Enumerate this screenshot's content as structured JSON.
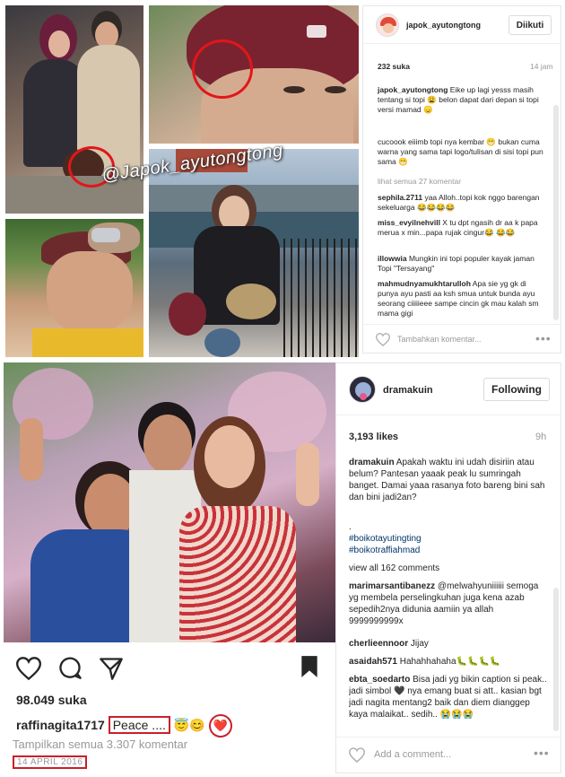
{
  "watermark": "@Japok_ayutongtong",
  "post1": {
    "username": "japok_ayutongtong",
    "follow_label": "Diikuti",
    "likes": "232 suka",
    "time": "14 jam",
    "caption": [
      {
        "user": "japok_ayutongtong",
        "text": " Eike up lagi yesss masih tentang si topi 😩 belon dapat dari depan si topi versi mamad 😞"
      },
      {
        "user": "",
        "text": "cucoook eiiimb topi nya kembar 😁 bukan cuma warna yang sama tapi logo/tulisan di sisi topi pun sama 😁"
      }
    ],
    "view_all": "lihat semua 27 komentar",
    "comments": [
      {
        "user": "sephila.2711",
        "text": " yaa Alloh..topi kok nggo barengan sekeluarga 😂😂😂😂"
      },
      {
        "user": "miss_evyilnehvill",
        "text": " X tu dpt ngasih dr aa k papa merua x min...papa rujak cingur😂 😂😂"
      },
      {
        "user": "illowwia",
        "text": " Mungkin ini topi populer kayak jaman Topi \"Tersayang\""
      },
      {
        "user": "mahmudnyamukhtarulloh",
        "text": " Apa sie yg gk di punya ayu pasti aa ksh smua untuk bunda ayu seorang ciiiiieee sampe cincin gk mau kalah sm mama gigi"
      }
    ],
    "add_comment": "Tambahkan komentar...",
    "more": "•••"
  },
  "post2": {
    "username": "dramakuin",
    "follow_label": "Following",
    "likes": "3,193 likes",
    "time": "9h",
    "caption_user": "dramakuin",
    "caption_text": " Apakah waktu ini udah disiriin atau belum? Pantesan yaaak peak lu sumringah banget. Damai yaaa rasanya foto bareng bini sah dan bini jadi2an?",
    "caption_dot": ".",
    "hashtags": [
      "#boikotayutingting",
      "#boikotraffiahmad"
    ],
    "view_all": "view all 162 comments",
    "comments": [
      {
        "user": "marimarsantibanezz",
        "text": " @melwahyuniiiiii semoga yg membela perselingkuhan juga kena azab sepedih2nya didunia aamiin ya allah 9999999999x"
      },
      {
        "user": "cherlieennoor",
        "text": " Jijay"
      },
      {
        "user": "asaidah571",
        "text": " Hahahhahaha🐛🐛🐛🐛"
      },
      {
        "user": "ebta_soedarto",
        "text": " Bisa jadi yg bikin caption si peak.. jadi simbol 🖤 nya emang buat si att.. kasian bgt jadi nagita mentang2 baik dan diem dianggep kaya malaikat.. sedih.. 😭😭😭"
      }
    ],
    "add_comment": "Add a comment...",
    "more": "•••"
  },
  "post3": {
    "likes": "98.049 suka",
    "username": "raffinagita1717",
    "caption_text": "Peace ....",
    "caption_emoji": "😇😊",
    "heart": "❤️",
    "view_all": "Tampilkan semua 3.307 komentar",
    "date": "14 APRIL 2016"
  },
  "icons": [
    "heart-icon",
    "comment-icon",
    "share-icon",
    "bookmark-icon"
  ]
}
